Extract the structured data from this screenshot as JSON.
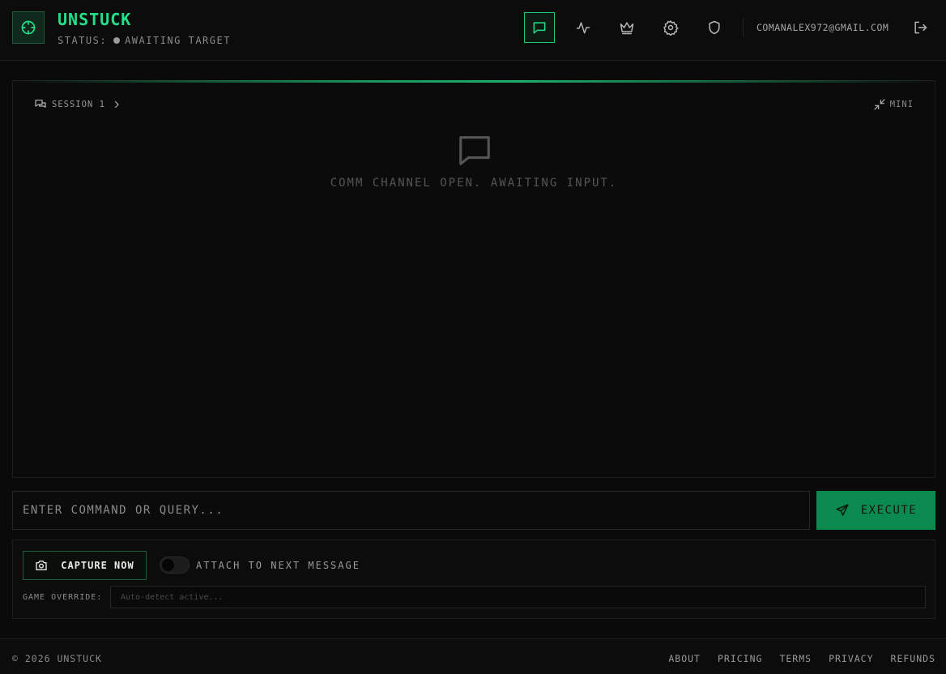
{
  "header": {
    "brand": "UNSTUCK",
    "status_label": "STATUS:",
    "status_value": "AWAITING TARGET",
    "nav": [
      {
        "icon": "chat-icon",
        "active": true
      },
      {
        "icon": "activity-icon",
        "active": false
      },
      {
        "icon": "crown-icon",
        "active": false
      },
      {
        "icon": "gear-icon",
        "active": false
      },
      {
        "icon": "shield-icon",
        "active": false
      }
    ],
    "email": "COMANALEX972@GMAIL.COM"
  },
  "chat": {
    "session_label": "SESSION 1",
    "mini_label": "MINI",
    "empty_message": "COMM CHANNEL OPEN. AWAITING INPUT."
  },
  "command": {
    "placeholder": "ENTER COMMAND OR QUERY...",
    "execute_label": "EXECUTE"
  },
  "capture": {
    "capture_label": "CAPTURE NOW",
    "attach_label": "ATTACH TO NEXT MESSAGE",
    "attach_enabled": false,
    "override_label": "GAME OVERRIDE:",
    "override_placeholder": "Auto-detect active..."
  },
  "footer": {
    "copyright": "© 2026 UNSTUCK",
    "links": [
      "ABOUT",
      "PRICING",
      "TERMS",
      "PRIVACY",
      "REFUNDS"
    ]
  },
  "colors": {
    "accent": "#22e08a",
    "execute_bg": "#0a8a4e",
    "background": "#0a0a0a"
  }
}
